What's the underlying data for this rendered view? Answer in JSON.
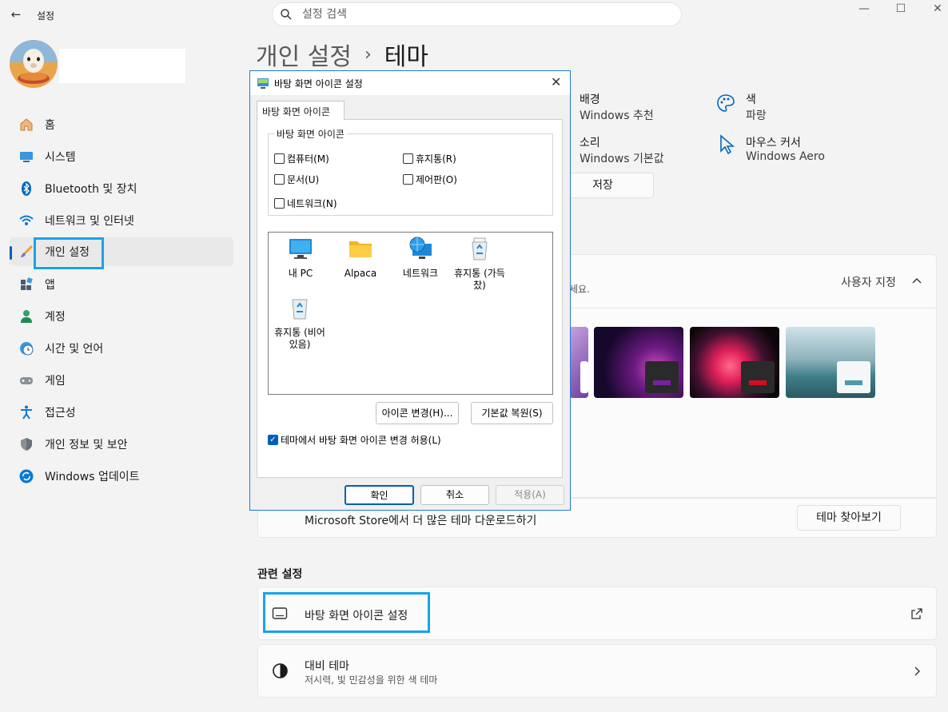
{
  "window": {
    "app_title": "설정",
    "controls": [
      "—",
      "☐",
      "✕"
    ]
  },
  "search": {
    "placeholder": "설정 검색"
  },
  "sidebar": {
    "items": [
      {
        "label": "홈",
        "icon": "home-icon"
      },
      {
        "label": "시스템",
        "icon": "monitor-icon"
      },
      {
        "label": "Bluetooth 및 장치",
        "icon": "bluetooth-icon"
      },
      {
        "label": "네트워크 및 인터넷",
        "icon": "wifi-icon"
      },
      {
        "label": "개인 설정",
        "icon": "paintbrush-icon"
      },
      {
        "label": "앱",
        "icon": "apps-icon"
      },
      {
        "label": "계정",
        "icon": "person-icon"
      },
      {
        "label": "시간 및 언어",
        "icon": "clock-globe-icon"
      },
      {
        "label": "게임",
        "icon": "gamepad-icon"
      },
      {
        "label": "접근성",
        "icon": "accessibility-icon"
      },
      {
        "label": "개인 정보 및 보안",
        "icon": "shield-icon"
      },
      {
        "label": "Windows 업데이트",
        "icon": "update-icon"
      }
    ],
    "active_index": 4
  },
  "breadcrumb": {
    "parent": "개인 설정",
    "separator": "›",
    "current": "테마"
  },
  "summary": {
    "background": {
      "title": "배경",
      "value": "Windows 추천"
    },
    "color": {
      "title": "색",
      "value": "파랑"
    },
    "sound": {
      "title": "소리",
      "value": "Windows 기본값"
    },
    "cursor": {
      "title": "마우스 커서",
      "value": "Windows Aero"
    },
    "save_label": "저장"
  },
  "themes_card": {
    "custom_label": "사용자 지정",
    "desc_tail": "세요."
  },
  "store": {
    "text": "Microsoft Store에서 더 많은 테마 다운로드하기",
    "button": "테마 찾아보기"
  },
  "related": {
    "heading": "관련 설정",
    "desktop_icons": "바탕 화면 아이콘 설정",
    "contrast_title": "대비 테마",
    "contrast_sub": "저시력, 빛 민감성을 위한 색 테마"
  },
  "dialog": {
    "title": "바탕 화면 아이콘 설정",
    "tab": "바탕 화면 아이콘",
    "group_label": "바탕 화면 아이콘",
    "checkboxes": {
      "computer": "컴퓨터(M)",
      "recycle": "휴지통(R)",
      "documents": "문서(U)",
      "control": "제어판(O)",
      "network": "네트워크(N)"
    },
    "icons": {
      "pc": "내 PC",
      "alpaca": "Alpaca",
      "network": "네트워크",
      "recycle_full": "휴지통 (가득 찼)",
      "recycle_empty": "휴지통 (비어 있음)"
    },
    "change_icon": "아이콘 변경(H)...",
    "restore_default": "기본값 복원(S)",
    "allow_themes": "테마에서 바탕 화면 아이콘 변경 허용(L)",
    "ok": "확인",
    "cancel": "취소",
    "apply": "적용(A)"
  },
  "colors": {
    "accent": "#005fb8",
    "highlight": "#1aa3e8"
  }
}
